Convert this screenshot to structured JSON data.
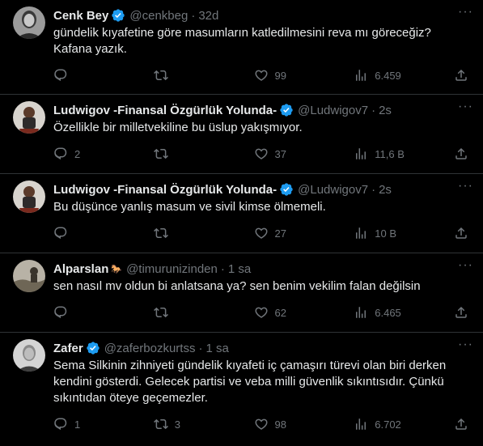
{
  "tweets": [
    {
      "name": "Cenk Bey",
      "handle": "@cenkbeg",
      "time": "32d",
      "text": [
        "gündelik kıyafetine göre masumların katledilmesini reva mı göreceğiz?",
        "Kafana yazık."
      ],
      "replies": "",
      "retweets": "",
      "likes": "99",
      "views": "6.459",
      "verified": true
    },
    {
      "name": "Ludwigov -Finansal Özgürlük Yolunda-",
      "handle": "@Ludwigov7",
      "time": "2s",
      "text": [
        "Özellikle bir milletvekiline bu üslup yakışmıyor."
      ],
      "replies": "2",
      "retweets": "",
      "likes": "37",
      "views": "11,6 B",
      "verified": true
    },
    {
      "name": "Ludwigov -Finansal Özgürlük Yolunda-",
      "handle": "@Ludwigov7",
      "time": "2s",
      "text": [
        "Bu düşünce yanlış masum ve sivil kimse ölmemeli."
      ],
      "replies": "",
      "retweets": "",
      "likes": "27",
      "views": "10 B",
      "verified": true
    },
    {
      "name": "Alparslan",
      "handle": "@timurunizinden",
      "time": "1 sa",
      "text": [
        "sen nasıl mv oldun bi anlatsana ya? sen benim vekilim falan değilsin"
      ],
      "replies": "",
      "retweets": "",
      "likes": "62",
      "views": "6.465",
      "verified": false,
      "name_emoji": "🐎"
    },
    {
      "name": "Zafer",
      "handle": "@zaferbozkurtss",
      "time": "1 sa",
      "text": [
        "Sema Silkinin zihniyeti gündelik kıyafeti iç çamaşırı türevi olan biri derken",
        "kendini gösterdi. Gelecek partisi ve veba milli güvenlik sıkıntısıdır. Çünkü",
        "sıkıntıdan öteye geçemezler."
      ],
      "replies": "1",
      "retweets": "3",
      "likes": "98",
      "views": "6.702",
      "verified": true
    }
  ],
  "ui": {
    "more_glyph": "···",
    "dot_glyph": "·",
    "colors": {
      "background": "#000000",
      "text": "#e7e9ea",
      "muted": "#71767b",
      "verified": "#1d9bf0",
      "divider": "#2f3336"
    },
    "icons": [
      "reply-icon",
      "retweet-icon",
      "like-icon",
      "views-icon",
      "share-icon",
      "verified-badge-icon",
      "more-icon"
    ]
  }
}
